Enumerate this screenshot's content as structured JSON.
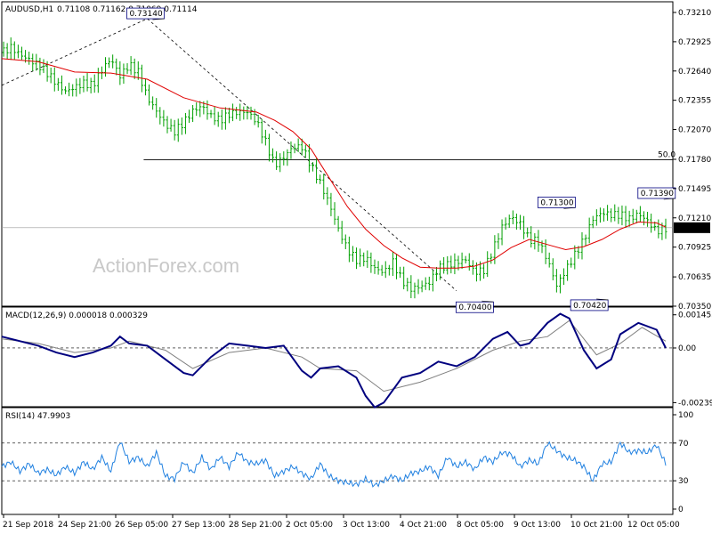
{
  "header": {
    "symbol": "AUDUSD,H1",
    "ohlc": "0.71108 0.71162 0.71069 0.71114"
  },
  "watermark": "ActionForex.com",
  "colors": {
    "candle": "#00a000",
    "sma": "#e00000",
    "macd": "#00007f",
    "signal": "#808080",
    "rsi": "#2080e0",
    "trendline": "#000000",
    "fib": "#000000",
    "last_price_box": "#000000"
  },
  "chart_data": [
    {
      "type": "candlestick",
      "name": "price",
      "y_ticks": [
        "0.73210",
        "0.72925",
        "0.72640",
        "0.72355",
        "0.72070",
        "0.71780",
        "0.71495",
        "0.71210",
        "0.70925",
        "0.70635",
        "0.70350"
      ],
      "ylim": [
        0.7035,
        0.7321
      ],
      "x_ticks": [
        "21 Sep 2018",
        "24 Sep 21:00",
        "26 Sep 05:00",
        "27 Sep 13:00",
        "28 Sep 21:00",
        "2 Oct 05:00",
        "3 Oct 13:00",
        "4 Oct 21:00",
        "8 Oct 05:00",
        "9 Oct 13:00",
        "10 Oct 21:00",
        "12 Oct 05:00"
      ],
      "last_price": "0.71114",
      "fib_label": "50.0",
      "fib_level": 0.71775,
      "close_path": [
        [
          0,
          0.7282
        ],
        [
          5,
          0.7287
        ],
        [
          10,
          0.728
        ],
        [
          15,
          0.7275
        ],
        [
          20,
          0.727
        ],
        [
          25,
          0.7262
        ],
        [
          30,
          0.7252
        ],
        [
          35,
          0.7244
        ],
        [
          40,
          0.7248
        ],
        [
          45,
          0.7252
        ],
        [
          50,
          0.725
        ],
        [
          55,
          0.7265
        ],
        [
          60,
          0.7276
        ],
        [
          65,
          0.7259
        ],
        [
          70,
          0.727
        ],
        [
          75,
          0.7263
        ],
        [
          80,
          0.7238
        ],
        [
          85,
          0.7225
        ],
        [
          90,
          0.7212
        ],
        [
          95,
          0.7205
        ],
        [
          100,
          0.7214
        ],
        [
          105,
          0.7225
        ],
        [
          110,
          0.723
        ],
        [
          115,
          0.722
        ],
        [
          120,
          0.7216
        ],
        [
          125,
          0.7222
        ],
        [
          130,
          0.7224
        ],
        [
          135,
          0.7224
        ],
        [
          140,
          0.7215
        ],
        [
          145,
          0.7195
        ],
        [
          150,
          0.7172
        ],
        [
          155,
          0.718
        ],
        [
          160,
          0.719
        ],
        [
          165,
          0.719
        ],
        [
          170,
          0.7172
        ],
        [
          175,
          0.7155
        ],
        [
          180,
          0.7135
        ],
        [
          185,
          0.711
        ],
        [
          190,
          0.709
        ],
        [
          195,
          0.708
        ],
        [
          200,
          0.7082
        ],
        [
          205,
          0.7072
        ],
        [
          210,
          0.7068
        ],
        [
          215,
          0.7078
        ],
        [
          220,
          0.706
        ],
        [
          225,
          0.7052
        ],
        [
          230,
          0.7054
        ],
        [
          235,
          0.7058
        ],
        [
          240,
          0.7072
        ],
        [
          245,
          0.7075
        ],
        [
          250,
          0.7078
        ],
        [
          255,
          0.708
        ],
        [
          260,
          0.7068
        ],
        [
          265,
          0.707
        ],
        [
          270,
          0.709
        ],
        [
          275,
          0.7112
        ],
        [
          280,
          0.7122
        ],
        [
          285,
          0.7115
        ],
        [
          290,
          0.71
        ],
        [
          295,
          0.7098
        ],
        [
          300,
          0.708
        ],
        [
          305,
          0.7055
        ],
        [
          310,
          0.707
        ],
        [
          315,
          0.7085
        ],
        [
          320,
          0.71
        ],
        [
          325,
          0.712
        ],
        [
          330,
          0.7126
        ],
        [
          335,
          0.7124
        ],
        [
          340,
          0.7124
        ],
        [
          345,
          0.712
        ],
        [
          350,
          0.7125
        ],
        [
          355,
          0.7118
        ],
        [
          360,
          0.7108
        ],
        [
          365,
          0.7111
        ]
      ],
      "sma_path": [
        [
          0,
          0.7276
        ],
        [
          20,
          0.7273
        ],
        [
          40,
          0.7263
        ],
        [
          60,
          0.7262
        ],
        [
          80,
          0.7256
        ],
        [
          100,
          0.7238
        ],
        [
          120,
          0.7228
        ],
        [
          140,
          0.7224
        ],
        [
          150,
          0.7216
        ],
        [
          160,
          0.7205
        ],
        [
          170,
          0.7188
        ],
        [
          180,
          0.716
        ],
        [
          190,
          0.7132
        ],
        [
          200,
          0.711
        ],
        [
          210,
          0.7094
        ],
        [
          220,
          0.7082
        ],
        [
          230,
          0.7073
        ],
        [
          240,
          0.7072
        ],
        [
          250,
          0.7072
        ],
        [
          260,
          0.7074
        ],
        [
          270,
          0.708
        ],
        [
          280,
          0.7092
        ],
        [
          290,
          0.71
        ],
        [
          300,
          0.7095
        ],
        [
          310,
          0.709
        ],
        [
          320,
          0.7093
        ],
        [
          330,
          0.71
        ],
        [
          340,
          0.711
        ],
        [
          350,
          0.7117
        ],
        [
          360,
          0.7116
        ],
        [
          365,
          0.7112
        ]
      ],
      "annotations": [
        {
          "label": "0.73140",
          "at": [
            79,
            0.7314
          ]
        },
        {
          "label": "0.71300",
          "at": [
            305,
            0.713
          ]
        },
        {
          "label": "0.71390",
          "at": [
            360,
            0.7139
          ]
        },
        {
          "label": "0.70400",
          "at": [
            260,
            0.704
          ]
        },
        {
          "label": "0.70420",
          "at": [
            323,
            0.7042
          ]
        }
      ],
      "trendlines": [
        {
          "from": [
            0,
            0.725
          ],
          "to": [
            80,
            0.7315
          ]
        },
        {
          "from": [
            80,
            0.7315
          ],
          "to": [
            250,
            0.705
          ]
        }
      ]
    },
    {
      "type": "line",
      "name": "MACD(12,26,9)",
      "legend": "MACD(12,26,9) 0.000018 0.000329",
      "y_ticks": [
        "0.001455",
        "0.00",
        "-0.002399"
      ],
      "ylim": [
        -0.0025,
        0.0016
      ],
      "macd_path": [
        [
          0,
          0.0005
        ],
        [
          10,
          0.0003
        ],
        [
          20,
          0.0001
        ],
        [
          30,
          -0.0002
        ],
        [
          40,
          -0.0004
        ],
        [
          50,
          -0.0002
        ],
        [
          60,
          0.0001
        ],
        [
          65,
          0.0005
        ],
        [
          70,
          0.0002
        ],
        [
          80,
          0.0001
        ],
        [
          90,
          -0.0005
        ],
        [
          100,
          -0.0011
        ],
        [
          105,
          -0.0012
        ],
        [
          115,
          -0.0004
        ],
        [
          125,
          0.0002
        ],
        [
          135,
          0.0001
        ],
        [
          145,
          0.0
        ],
        [
          155,
          0.0001
        ],
        [
          165,
          -0.001
        ],
        [
          170,
          -0.0013
        ],
        [
          175,
          -0.0009
        ],
        [
          185,
          -0.0008
        ],
        [
          195,
          -0.0013
        ],
        [
          200,
          -0.0021
        ],
        [
          205,
          -0.0026
        ],
        [
          210,
          -0.0024
        ],
        [
          220,
          -0.0013
        ],
        [
          230,
          -0.0011
        ],
        [
          240,
          -0.0006
        ],
        [
          250,
          -0.0008
        ],
        [
          260,
          -0.0004
        ],
        [
          270,
          0.0004
        ],
        [
          278,
          0.0007
        ],
        [
          285,
          0.0001
        ],
        [
          290,
          0.0002
        ],
        [
          300,
          0.0011
        ],
        [
          307,
          0.0015
        ],
        [
          312,
          0.0013
        ],
        [
          320,
          -0.0001
        ],
        [
          327,
          -0.0009
        ],
        [
          335,
          -0.0005
        ],
        [
          340,
          0.0006
        ],
        [
          350,
          0.0011
        ],
        [
          360,
          0.0008
        ],
        [
          365,
          0.0
        ]
      ],
      "signal_path": [
        [
          0,
          0.0004
        ],
        [
          20,
          0.0002
        ],
        [
          40,
          -0.0002
        ],
        [
          60,
          0.0
        ],
        [
          70,
          0.0003
        ],
        [
          90,
          -0.0001
        ],
        [
          105,
          -0.0009
        ],
        [
          125,
          -0.0002
        ],
        [
          145,
          0.0
        ],
        [
          165,
          -0.0004
        ],
        [
          175,
          -0.0009
        ],
        [
          195,
          -0.001
        ],
        [
          210,
          -0.0019
        ],
        [
          230,
          -0.0015
        ],
        [
          250,
          -0.0009
        ],
        [
          270,
          -0.0001
        ],
        [
          285,
          0.0003
        ],
        [
          300,
          0.0005
        ],
        [
          312,
          0.0012
        ],
        [
          327,
          -0.0003
        ],
        [
          340,
          0.0002
        ],
        [
          352,
          0.0009
        ],
        [
          365,
          0.0003
        ]
      ]
    },
    {
      "type": "line",
      "name": "RSI(14)",
      "legend": "RSI(14) 47.9903",
      "y_ticks": [
        "100",
        "70",
        "30",
        "0"
      ],
      "ylim": [
        0,
        100
      ],
      "levels": [
        70,
        30
      ],
      "rsi_path": [
        [
          0,
          45
        ],
        [
          5,
          50
        ],
        [
          10,
          40
        ],
        [
          15,
          48
        ],
        [
          20,
          38
        ],
        [
          25,
          42
        ],
        [
          30,
          36
        ],
        [
          35,
          45
        ],
        [
          40,
          38
        ],
        [
          45,
          50
        ],
        [
          50,
          42
        ],
        [
          55,
          55
        ],
        [
          60,
          40
        ],
        [
          65,
          72
        ],
        [
          70,
          50
        ],
        [
          75,
          55
        ],
        [
          80,
          45
        ],
        [
          85,
          60
        ],
        [
          90,
          35
        ],
        [
          95,
          32
        ],
        [
          100,
          50
        ],
        [
          105,
          38
        ],
        [
          110,
          55
        ],
        [
          115,
          42
        ],
        [
          120,
          55
        ],
        [
          125,
          45
        ],
        [
          130,
          60
        ],
        [
          135,
          50
        ],
        [
          140,
          48
        ],
        [
          145,
          52
        ],
        [
          150,
          35
        ],
        [
          155,
          40
        ],
        [
          160,
          45
        ],
        [
          165,
          38
        ],
        [
          170,
          32
        ],
        [
          175,
          48
        ],
        [
          180,
          35
        ],
        [
          185,
          30
        ],
        [
          190,
          28
        ],
        [
          195,
          26
        ],
        [
          200,
          32
        ],
        [
          205,
          25
        ],
        [
          210,
          30
        ],
        [
          215,
          35
        ],
        [
          220,
          30
        ],
        [
          225,
          38
        ],
        [
          230,
          40
        ],
        [
          235,
          45
        ],
        [
          240,
          35
        ],
        [
          245,
          55
        ],
        [
          250,
          45
        ],
        [
          255,
          50
        ],
        [
          260,
          42
        ],
        [
          265,
          55
        ],
        [
          270,
          50
        ],
        [
          275,
          60
        ],
        [
          280,
          58
        ],
        [
          285,
          45
        ],
        [
          290,
          52
        ],
        [
          295,
          48
        ],
        [
          300,
          70
        ],
        [
          305,
          62
        ],
        [
          310,
          55
        ],
        [
          315,
          52
        ],
        [
          320,
          45
        ],
        [
          325,
          30
        ],
        [
          330,
          48
        ],
        [
          335,
          50
        ],
        [
          340,
          70
        ],
        [
          345,
          60
        ],
        [
          350,
          62
        ],
        [
          355,
          60
        ],
        [
          360,
          68
        ],
        [
          365,
          48
        ]
      ]
    }
  ]
}
